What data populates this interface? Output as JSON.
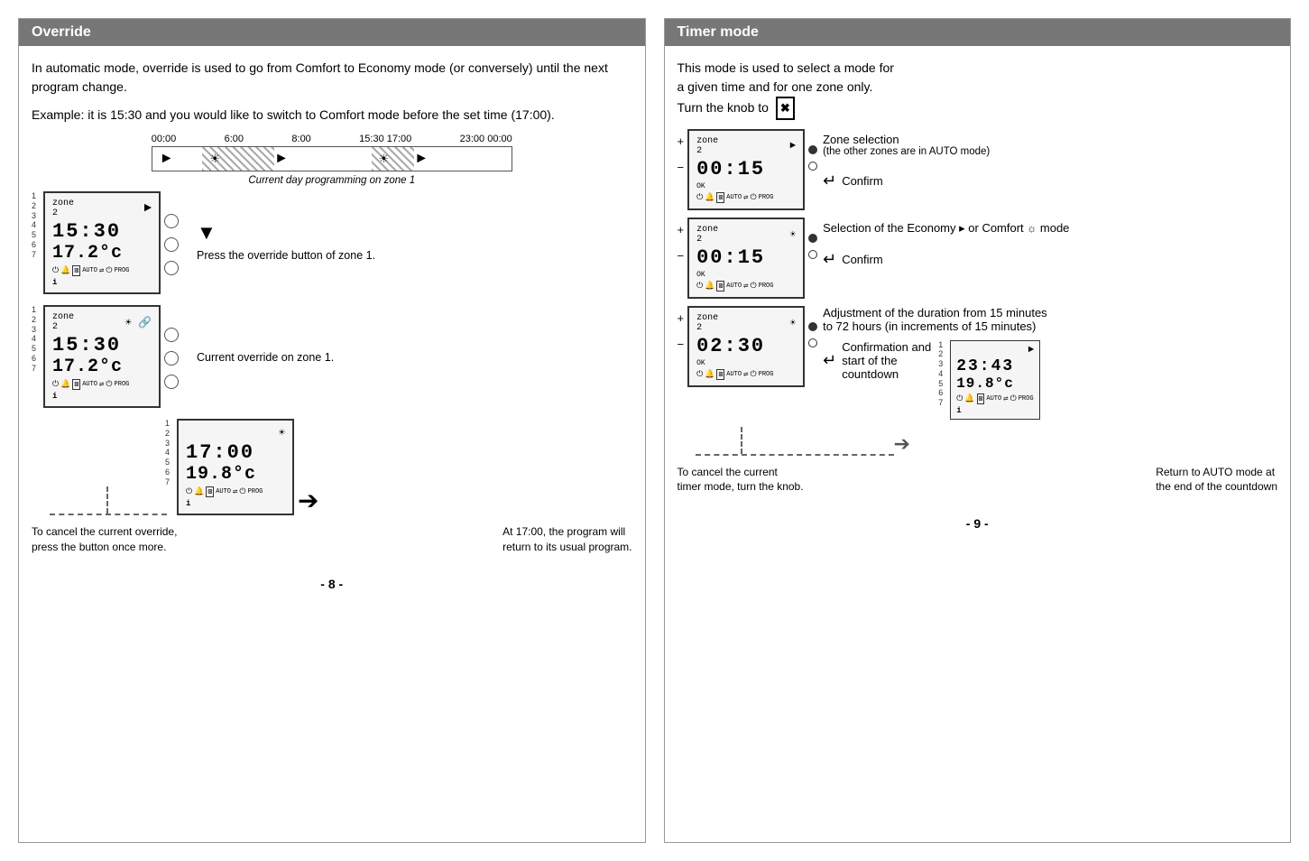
{
  "override": {
    "title": "Override",
    "intro1": "In automatic mode, override is used to go from Comfort to Economy mode (or conversely) until the next program change.",
    "intro2": "Example: it is 15:30 and you would like to switch to Comfort mode before the set time (17:00).",
    "timeline": {
      "labels": [
        "00:00",
        "6:00",
        "8:00",
        "15:30  17:00",
        "23:00  00:00"
      ],
      "caption": "Current day programming on zone 1"
    },
    "step1": {
      "time": "15:30",
      "temp": "17.2°c",
      "label": "Press the override button of zone 1.",
      "zone": "zone 2",
      "num_col": "1\n2\n3\n4\n5\n6\n7"
    },
    "step2": {
      "time": "15:30",
      "temp": "17.2°c",
      "label": "Current override on zone 1.",
      "zone": "zone 2",
      "num_col": "1\n2\n3\n4\n5\n6\n7"
    },
    "step2b": {
      "time": "17:00",
      "temp": "19.8°c",
      "num_col": "1\n2\n3\n4\n5\n6\n7"
    },
    "bottom": {
      "cancel_text": "To cancel the current override,\npress the button once more.",
      "at_text": "At 17:00, the program will\nreturn to its usual program."
    }
  },
  "timer": {
    "title": "Timer mode",
    "intro1": "This mode is used to select a mode for",
    "intro2": "a given time and for one zone only.",
    "intro3": "Turn the knob to",
    "knob_symbol": "⊠",
    "rows": [
      {
        "display": {
          "zone": "zone 2",
          "time": "00:15",
          "pm": [
            "+",
            "–"
          ]
        },
        "labels": [
          "Zone selection",
          "(the other zones are in AUTO mode)"
        ],
        "confirm": "Confirm"
      },
      {
        "display": {
          "zone": "zone 2",
          "time": "00:15",
          "pm": [
            "+",
            "–"
          ]
        },
        "labels": [
          "Selection of the Economy  or Comfort  mode"
        ],
        "confirm": "Confirm"
      },
      {
        "display": {
          "zone": "zone 2",
          "time": "02:30",
          "pm": [
            "+",
            "–"
          ]
        },
        "labels": [
          "Adjustment of the duration from 15 minutes",
          "to 72 hours (in increments of 15 minutes)"
        ],
        "confirm_label": "Confirmation and\nstart of the\ncountdown",
        "display2": {
          "time": "23:43",
          "temp": "19.8°c",
          "num_col": "1\n2\n3\n4\n5\n6\n7"
        }
      }
    ],
    "bottom": {
      "cancel_text": "To cancel the current\ntimer mode, turn the knob.",
      "return_text": "Return to AUTO mode at\nthe end of the countdown"
    }
  },
  "page_numbers": {
    "left": "- 8 -",
    "right": "- 9 -"
  }
}
